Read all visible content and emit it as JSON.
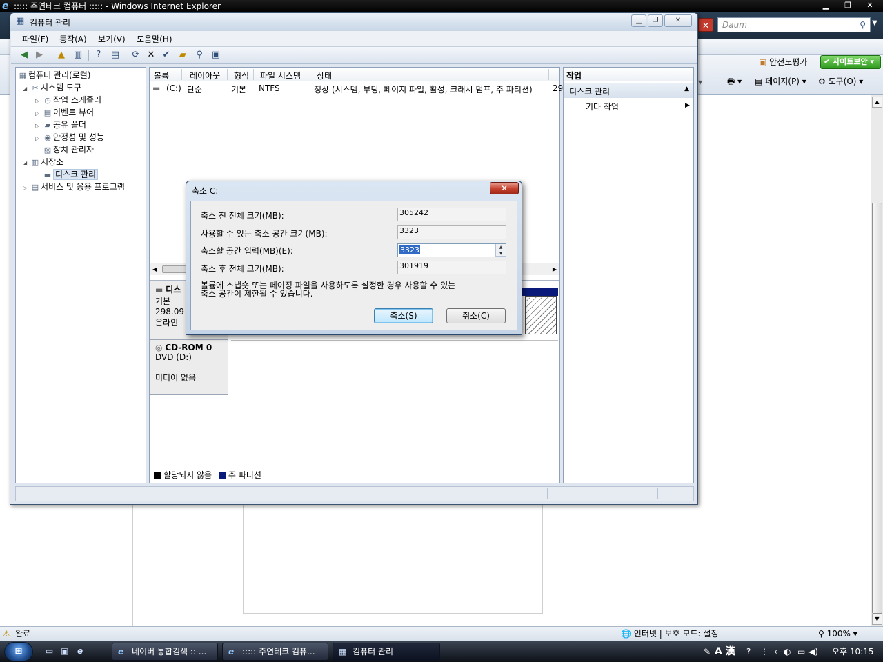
{
  "ie": {
    "title": "::::: 주연테크 컴퓨터 ::::: - Windows Internet Explorer",
    "search_placeholder": "Daum",
    "safety_rating": "안전도평가",
    "site_security": "사이트보안",
    "page_menu": "페이지(P)",
    "tools_menu": "도구(O)",
    "status_text": "완료",
    "zone_text": "인터넷 | 보호 모드: 설정",
    "zoom": "100%"
  },
  "taskbar": {
    "start": "⊞",
    "buttons": [
      "네이버 통합검색 :: ...",
      "::::: 주연테크 컴퓨...",
      "컴퓨터 관리"
    ],
    "ime": "A 漢",
    "clock": "오후 10:15"
  },
  "mmc": {
    "title": "컴퓨터 관리",
    "menu": [
      "파일(F)",
      "동작(A)",
      "보기(V)",
      "도움말(H)"
    ],
    "tree": {
      "root": "컴퓨터 관리(로컬)",
      "system_tools": "시스템 도구",
      "task_scheduler": "작업 스케줄러",
      "event_viewer": "이벤트 뷰어",
      "shared_folders": "공유 폴더",
      "reliability": "안정성 및 성능",
      "device_manager": "장치 관리자",
      "storage": "저장소",
      "disk_management": "디스크 관리",
      "services_apps": "서비스 및 응용 프로그램"
    },
    "columns": [
      "볼륨",
      "레이아웃",
      "형식",
      "파일 시스템",
      "상태"
    ],
    "volume_row": {
      "volume": "(C:)",
      "layout": "단순",
      "type": "기본",
      "fs": "NTFS",
      "status": "정상 (시스템, 부팅, 페이지 파일, 활성, 크래시 덤프, 주 파티션)",
      "capacity": "29"
    },
    "disk0": {
      "name": "디스",
      "type": "기본",
      "size": "298.09 (",
      "state": "온라인"
    },
    "cdrom": {
      "name": "CD-ROM 0",
      "drive": "DVD (D:)",
      "media": "미디어 없음"
    },
    "legend": {
      "unallocated": "할당되지 않음",
      "primary": "주 파티션",
      "unallocated_color": "#000000",
      "primary_color": "#0a1a7a"
    },
    "actions": {
      "header": "작업",
      "section": "디스크 관리",
      "item": "기타 작업"
    }
  },
  "dialog": {
    "title": "축소 C:",
    "close": "✕",
    "total_before_label": "축소 전 전체 크기(MB):",
    "total_before_value": "305242",
    "available_label": "사용할 수 있는 축소 공간 크기(MB):",
    "available_value": "3323",
    "shrink_label": "축소할 공간 입력(MB)(E):",
    "shrink_value": "3323",
    "total_after_label": "축소 후 전체 크기(MB):",
    "total_after_value": "301919",
    "note_line1": "볼륨에 스냅숏 또는 페이징 파일을 사용하도록 설정한 경우 사용할 수 있는",
    "note_line2": "축소 공간이 제한될 수 있습니다.",
    "shrink_button": "축소(S)",
    "cancel_button": "취소(C)"
  }
}
